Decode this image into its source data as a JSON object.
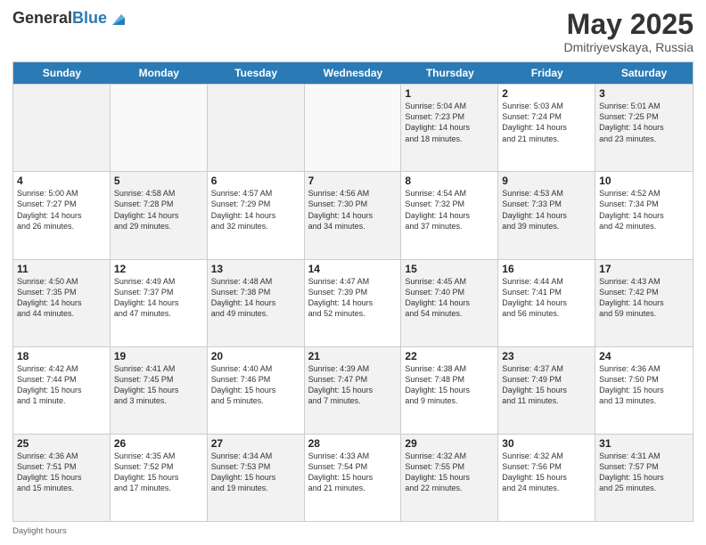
{
  "header": {
    "logo_line1": "General",
    "logo_line2": "Blue",
    "month_title": "May 2025",
    "location": "Dmitriyevskaya, Russia"
  },
  "weekdays": [
    "Sunday",
    "Monday",
    "Tuesday",
    "Wednesday",
    "Thursday",
    "Friday",
    "Saturday"
  ],
  "footer": {
    "daylight_label": "Daylight hours"
  },
  "weeks": [
    [
      {
        "day": "",
        "detail": "",
        "shaded": true
      },
      {
        "day": "",
        "detail": "",
        "shaded": false
      },
      {
        "day": "",
        "detail": "",
        "shaded": true
      },
      {
        "day": "",
        "detail": "",
        "shaded": false
      },
      {
        "day": "1",
        "detail": "Sunrise: 5:04 AM\nSunset: 7:23 PM\nDaylight: 14 hours\nand 18 minutes.",
        "shaded": true
      },
      {
        "day": "2",
        "detail": "Sunrise: 5:03 AM\nSunset: 7:24 PM\nDaylight: 14 hours\nand 21 minutes.",
        "shaded": false
      },
      {
        "day": "3",
        "detail": "Sunrise: 5:01 AM\nSunset: 7:25 PM\nDaylight: 14 hours\nand 23 minutes.",
        "shaded": true
      }
    ],
    [
      {
        "day": "4",
        "detail": "Sunrise: 5:00 AM\nSunset: 7:27 PM\nDaylight: 14 hours\nand 26 minutes.",
        "shaded": false
      },
      {
        "day": "5",
        "detail": "Sunrise: 4:58 AM\nSunset: 7:28 PM\nDaylight: 14 hours\nand 29 minutes.",
        "shaded": true
      },
      {
        "day": "6",
        "detail": "Sunrise: 4:57 AM\nSunset: 7:29 PM\nDaylight: 14 hours\nand 32 minutes.",
        "shaded": false
      },
      {
        "day": "7",
        "detail": "Sunrise: 4:56 AM\nSunset: 7:30 PM\nDaylight: 14 hours\nand 34 minutes.",
        "shaded": true
      },
      {
        "day": "8",
        "detail": "Sunrise: 4:54 AM\nSunset: 7:32 PM\nDaylight: 14 hours\nand 37 minutes.",
        "shaded": false
      },
      {
        "day": "9",
        "detail": "Sunrise: 4:53 AM\nSunset: 7:33 PM\nDaylight: 14 hours\nand 39 minutes.",
        "shaded": true
      },
      {
        "day": "10",
        "detail": "Sunrise: 4:52 AM\nSunset: 7:34 PM\nDaylight: 14 hours\nand 42 minutes.",
        "shaded": false
      }
    ],
    [
      {
        "day": "11",
        "detail": "Sunrise: 4:50 AM\nSunset: 7:35 PM\nDaylight: 14 hours\nand 44 minutes.",
        "shaded": true
      },
      {
        "day": "12",
        "detail": "Sunrise: 4:49 AM\nSunset: 7:37 PM\nDaylight: 14 hours\nand 47 minutes.",
        "shaded": false
      },
      {
        "day": "13",
        "detail": "Sunrise: 4:48 AM\nSunset: 7:38 PM\nDaylight: 14 hours\nand 49 minutes.",
        "shaded": true
      },
      {
        "day": "14",
        "detail": "Sunrise: 4:47 AM\nSunset: 7:39 PM\nDaylight: 14 hours\nand 52 minutes.",
        "shaded": false
      },
      {
        "day": "15",
        "detail": "Sunrise: 4:45 AM\nSunset: 7:40 PM\nDaylight: 14 hours\nand 54 minutes.",
        "shaded": true
      },
      {
        "day": "16",
        "detail": "Sunrise: 4:44 AM\nSunset: 7:41 PM\nDaylight: 14 hours\nand 56 minutes.",
        "shaded": false
      },
      {
        "day": "17",
        "detail": "Sunrise: 4:43 AM\nSunset: 7:42 PM\nDaylight: 14 hours\nand 59 minutes.",
        "shaded": true
      }
    ],
    [
      {
        "day": "18",
        "detail": "Sunrise: 4:42 AM\nSunset: 7:44 PM\nDaylight: 15 hours\nand 1 minute.",
        "shaded": false
      },
      {
        "day": "19",
        "detail": "Sunrise: 4:41 AM\nSunset: 7:45 PM\nDaylight: 15 hours\nand 3 minutes.",
        "shaded": true
      },
      {
        "day": "20",
        "detail": "Sunrise: 4:40 AM\nSunset: 7:46 PM\nDaylight: 15 hours\nand 5 minutes.",
        "shaded": false
      },
      {
        "day": "21",
        "detail": "Sunrise: 4:39 AM\nSunset: 7:47 PM\nDaylight: 15 hours\nand 7 minutes.",
        "shaded": true
      },
      {
        "day": "22",
        "detail": "Sunrise: 4:38 AM\nSunset: 7:48 PM\nDaylight: 15 hours\nand 9 minutes.",
        "shaded": false
      },
      {
        "day": "23",
        "detail": "Sunrise: 4:37 AM\nSunset: 7:49 PM\nDaylight: 15 hours\nand 11 minutes.",
        "shaded": true
      },
      {
        "day": "24",
        "detail": "Sunrise: 4:36 AM\nSunset: 7:50 PM\nDaylight: 15 hours\nand 13 minutes.",
        "shaded": false
      }
    ],
    [
      {
        "day": "25",
        "detail": "Sunrise: 4:36 AM\nSunset: 7:51 PM\nDaylight: 15 hours\nand 15 minutes.",
        "shaded": true
      },
      {
        "day": "26",
        "detail": "Sunrise: 4:35 AM\nSunset: 7:52 PM\nDaylight: 15 hours\nand 17 minutes.",
        "shaded": false
      },
      {
        "day": "27",
        "detail": "Sunrise: 4:34 AM\nSunset: 7:53 PM\nDaylight: 15 hours\nand 19 minutes.",
        "shaded": true
      },
      {
        "day": "28",
        "detail": "Sunrise: 4:33 AM\nSunset: 7:54 PM\nDaylight: 15 hours\nand 21 minutes.",
        "shaded": false
      },
      {
        "day": "29",
        "detail": "Sunrise: 4:32 AM\nSunset: 7:55 PM\nDaylight: 15 hours\nand 22 minutes.",
        "shaded": true
      },
      {
        "day": "30",
        "detail": "Sunrise: 4:32 AM\nSunset: 7:56 PM\nDaylight: 15 hours\nand 24 minutes.",
        "shaded": false
      },
      {
        "day": "31",
        "detail": "Sunrise: 4:31 AM\nSunset: 7:57 PM\nDaylight: 15 hours\nand 25 minutes.",
        "shaded": true
      }
    ]
  ]
}
